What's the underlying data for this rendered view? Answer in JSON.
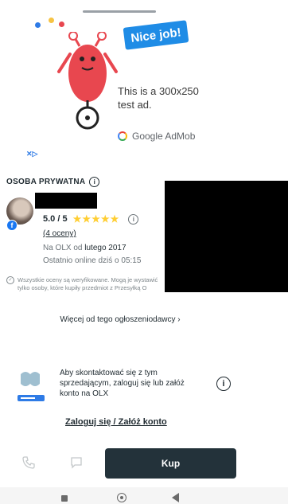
{
  "ad": {
    "badge": "Nice job!",
    "text": "This is a 300x250 test ad.",
    "brand": "Google AdMob",
    "adchoices": "✕▷"
  },
  "seller": {
    "type_label": "OSOBA PRYWATNA",
    "info_icon": "i",
    "fb_badge": "f",
    "rating_value": "5.0 / 5",
    "stars": "★★★★★",
    "reviews_link": "(4 oceny)",
    "since_prefix": "Na OLX od",
    "since_date": "lutego 2017",
    "online": "Ostatnio online dziś o 05:15",
    "notice": "Wszystkie oceny są weryfikowane. Mogą je wystawić tylko osoby, które kupiły przedmiot z Przesyłką O"
  },
  "more_ads": "Więcej od tego ogłoszeniodawcy  ›",
  "login": {
    "text": "Aby skontaktować się z tym sprzedającym, zaloguj się lub załóż konto na OLX",
    "info_icon": "i",
    "link": "Zaloguj się / Załóż konto"
  },
  "actions": {
    "buy_label": "Kup"
  },
  "colors": {
    "primary_dark": "#23323a",
    "ad_blue": "#1f8ce6",
    "star": "#ffce32",
    "monster": "#e8474f"
  }
}
